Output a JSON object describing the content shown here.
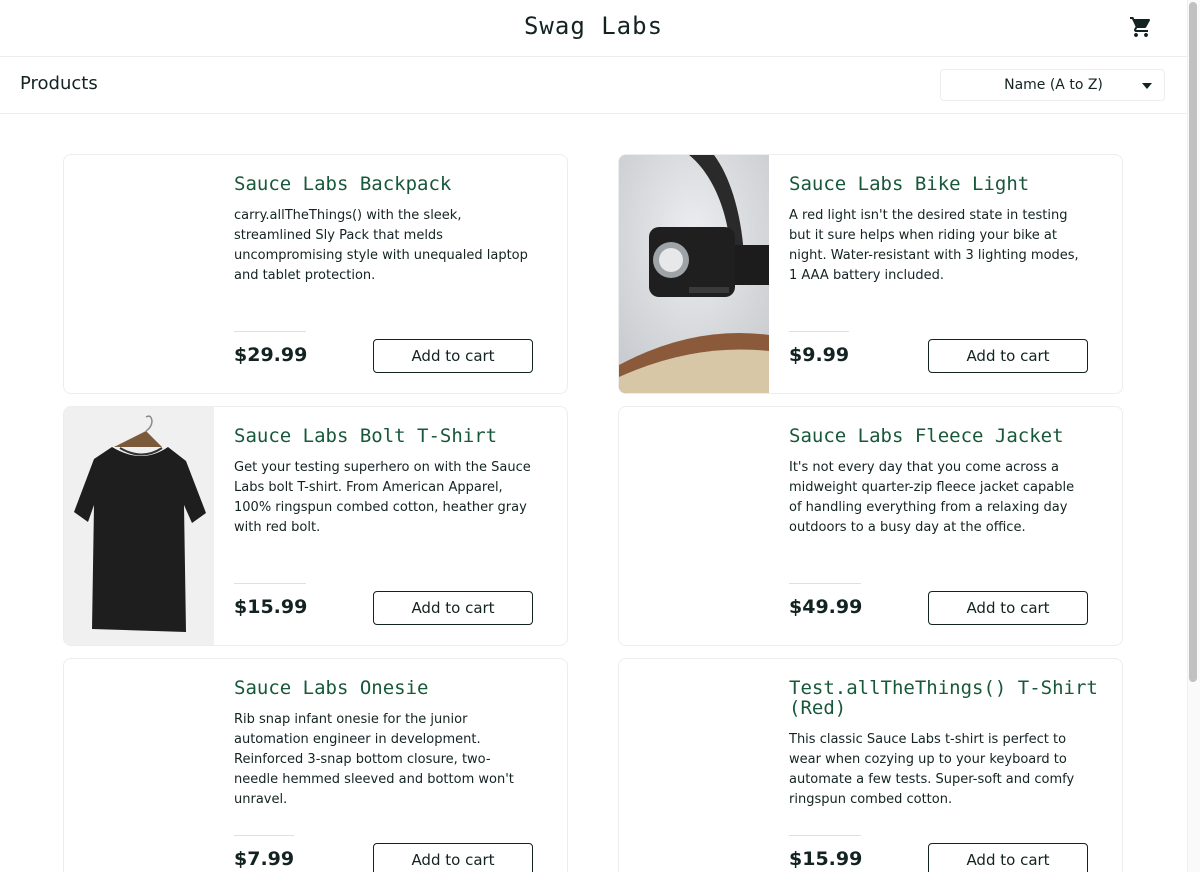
{
  "header": {
    "app_title": "Swag Labs",
    "cart_icon": "shopping-cart-icon"
  },
  "secondary": {
    "title": "Products",
    "sort_selected": "Name (A to Z)"
  },
  "products": [
    {
      "name": "Sauce Labs Backpack",
      "description": "carry.allTheThings() with the sleek, streamlined Sly Pack that melds uncompromising style with unequaled laptop and tablet protection.",
      "price": "$29.99",
      "button": "Add to cart",
      "image": "none"
    },
    {
      "name": "Sauce Labs Bike Light",
      "description": "A red light isn't the desired state in testing but it sure helps when riding your bike at night. Water-resistant with 3 lighting modes, 1 AAA battery included.",
      "price": "$9.99",
      "button": "Add to cart",
      "image": "bike-light-photo"
    },
    {
      "name": "Sauce Labs Bolt T-Shirt",
      "description": "Get your testing superhero on with the Sauce Labs bolt T-shirt. From American Apparel, 100% ringspun combed cotton, heather gray with red bolt.",
      "price": "$15.99",
      "button": "Add to cart",
      "image": "black-tshirt-photo"
    },
    {
      "name": "Sauce Labs Fleece Jacket",
      "description": "It's not every day that you come across a midweight quarter-zip fleece jacket capable of handling everything from a relaxing day outdoors to a busy day at the office.",
      "price": "$49.99",
      "button": "Add to cart",
      "image": "none"
    },
    {
      "name": "Sauce Labs Onesie",
      "description": "Rib snap infant onesie for the junior automation engineer in development. Reinforced 3-snap bottom closure, two-needle hemmed sleeved and bottom won't unravel.",
      "price": "$7.99",
      "button": "Add to cart",
      "image": "none"
    },
    {
      "name": "Test.allTheThings() T-Shirt (Red)",
      "description": "This classic Sauce Labs t-shirt is perfect to wear when cozying up to your keyboard to automate a few tests. Super-soft and comfy ringspun combed cotton.",
      "price": "$15.99",
      "button": "Add to cart",
      "image": "none"
    }
  ],
  "colors": {
    "product_name": "#18583a",
    "text": "#132322",
    "border": "#ededed"
  }
}
